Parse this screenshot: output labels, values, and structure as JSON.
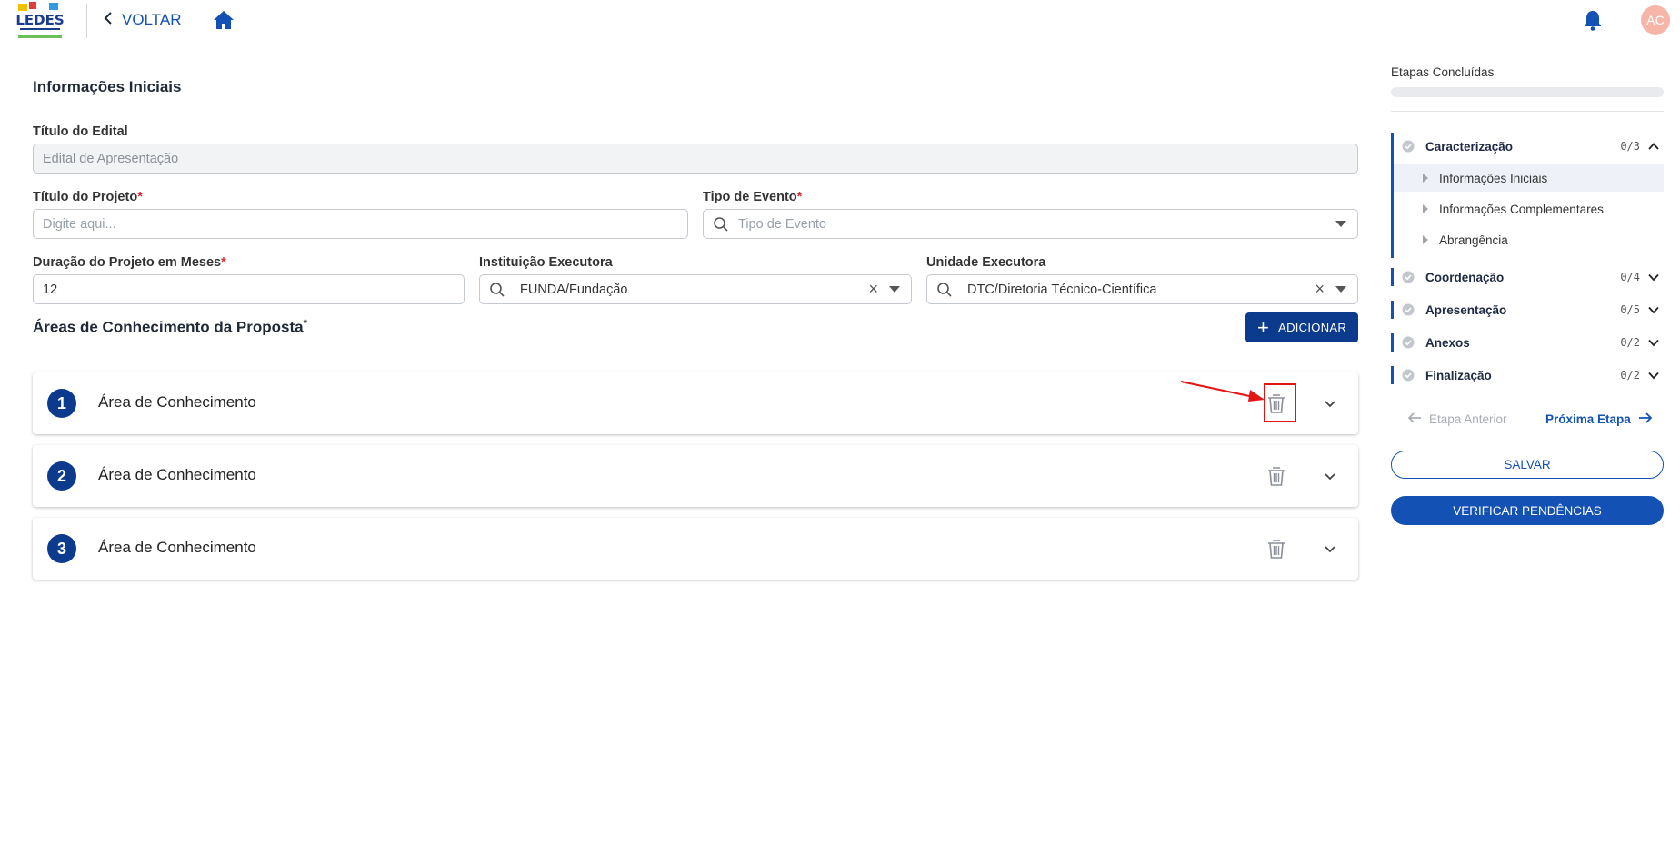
{
  "header": {
    "back_label": "VOLTAR",
    "avatar_initials": "AC"
  },
  "form": {
    "section_title": "Informações Iniciais",
    "edital": {
      "label": "Título do Edital",
      "placeholder": "Edital de Apresentação"
    },
    "projeto": {
      "label": "Título do Projeto",
      "required": "*",
      "placeholder": "Digite aqui..."
    },
    "tipo_evento": {
      "label": "Tipo de Evento",
      "required": "*",
      "placeholder": "Tipo de Evento"
    },
    "duracao": {
      "label": "Duração do Projeto em Meses",
      "required": "*",
      "value": "12"
    },
    "instituicao": {
      "label": "Instituição Executora",
      "value": "FUNDA/Fundação"
    },
    "unidade": {
      "label": "Unidade Executora",
      "value": "DTC/Diretoria Técnico-Científica"
    }
  },
  "areas": {
    "title": "Áreas de Conhecimento da Proposta",
    "required": "*",
    "add_label": "ADICIONAR",
    "items": [
      {
        "number": "1",
        "label": "Área de Conhecimento"
      },
      {
        "number": "2",
        "label": "Área de Conhecimento"
      },
      {
        "number": "3",
        "label": "Área de Conhecimento"
      }
    ]
  },
  "sidebar": {
    "title": "Etapas Concluídas",
    "progress": 0,
    "steps": [
      {
        "name": "Caracterização",
        "count": "0/3",
        "expanded": true,
        "subitems": [
          "Informações Iniciais",
          "Informações Complementares",
          "Abrangência"
        ]
      },
      {
        "name": "Coordenação",
        "count": "0/4"
      },
      {
        "name": "Apresentação",
        "count": "0/5"
      },
      {
        "name": "Anexos",
        "count": "0/2"
      },
      {
        "name": "Finalização",
        "count": "0/2"
      }
    ],
    "prev_label": "Etapa Anterior",
    "next_label": "Próxima Etapa",
    "save_label": "SALVAR",
    "verify_label": "VERIFICAR PENDÊNCIAS"
  },
  "colors": {
    "primary": "#1351b4",
    "dark_primary": "#0c3a8c",
    "highlight": "#e21414"
  }
}
